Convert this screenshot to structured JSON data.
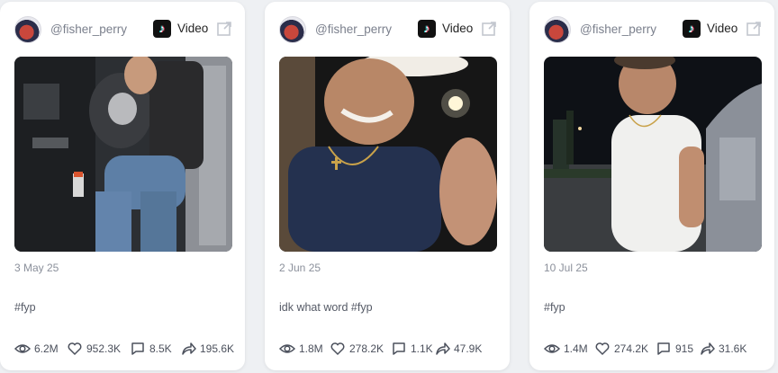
{
  "cards": [
    {
      "username": "@fisher_perry",
      "platform_icon": "tiktok-icon",
      "type_label": "Video",
      "date": "3 May 25",
      "caption": "#fyp",
      "stats": {
        "views": "6.2M",
        "likes": "952.3K",
        "comments": "8.5K",
        "shares": "195.6K"
      }
    },
    {
      "username": "@fisher_perry",
      "platform_icon": "tiktok-icon",
      "type_label": "Video",
      "date": "2 Jun 25",
      "caption": "idk what word #fyp",
      "stats": {
        "views": "1.8M",
        "likes": "278.2K",
        "comments": "1.1K",
        "shares": "47.9K"
      }
    },
    {
      "username": "@fisher_perry",
      "platform_icon": "tiktok-icon",
      "type_label": "Video",
      "date": "10 Jul 25",
      "caption": "#fyp",
      "stats": {
        "views": "1.4M",
        "likes": "274.2K",
        "comments": "915",
        "shares": "31.6K"
      }
    }
  ]
}
